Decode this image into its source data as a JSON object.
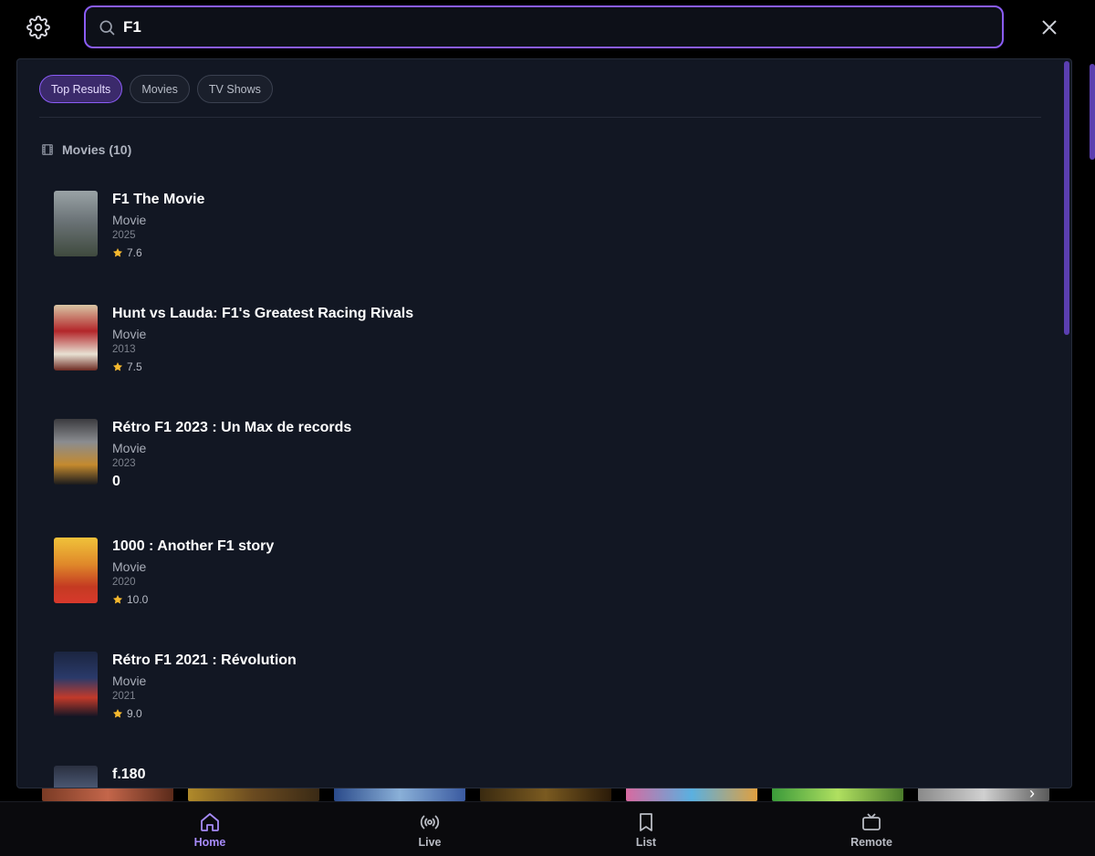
{
  "search": {
    "value": "F1",
    "placeholder": ""
  },
  "filters": [
    {
      "label": "Top Results",
      "active": true
    },
    {
      "label": "Movies",
      "active": false
    },
    {
      "label": "TV Shows",
      "active": false
    }
  ],
  "section": {
    "label": "Movies (10)"
  },
  "results": [
    {
      "title": "F1 The Movie",
      "type": "Movie",
      "year": "2025",
      "rating": "7.6"
    },
    {
      "title": "Hunt vs Lauda: F1's Greatest Racing Rivals",
      "type": "Movie",
      "year": "2013",
      "rating": "7.5"
    },
    {
      "title": "Rétro F1 2023 : Un Max de records",
      "type": "Movie",
      "year": "2023",
      "rating_zero": "0"
    },
    {
      "title": "1000 : Another F1 story",
      "type": "Movie",
      "year": "2020",
      "rating": "10.0"
    },
    {
      "title": "Rétro F1 2021 : Révolution",
      "type": "Movie",
      "year": "2021",
      "rating": "9.0"
    },
    {
      "title": "f.180"
    }
  ],
  "nav": [
    {
      "label": "Home",
      "icon": "home-icon",
      "active": true
    },
    {
      "label": "Live",
      "icon": "broadcast-icon",
      "active": false
    },
    {
      "label": "List",
      "icon": "bookmark-icon",
      "active": false
    },
    {
      "label": "Remote",
      "icon": "tv-icon",
      "active": false
    }
  ],
  "colors": {
    "accent": "#8b5cf6",
    "panel": "#121723",
    "star": "#f5b82e"
  }
}
